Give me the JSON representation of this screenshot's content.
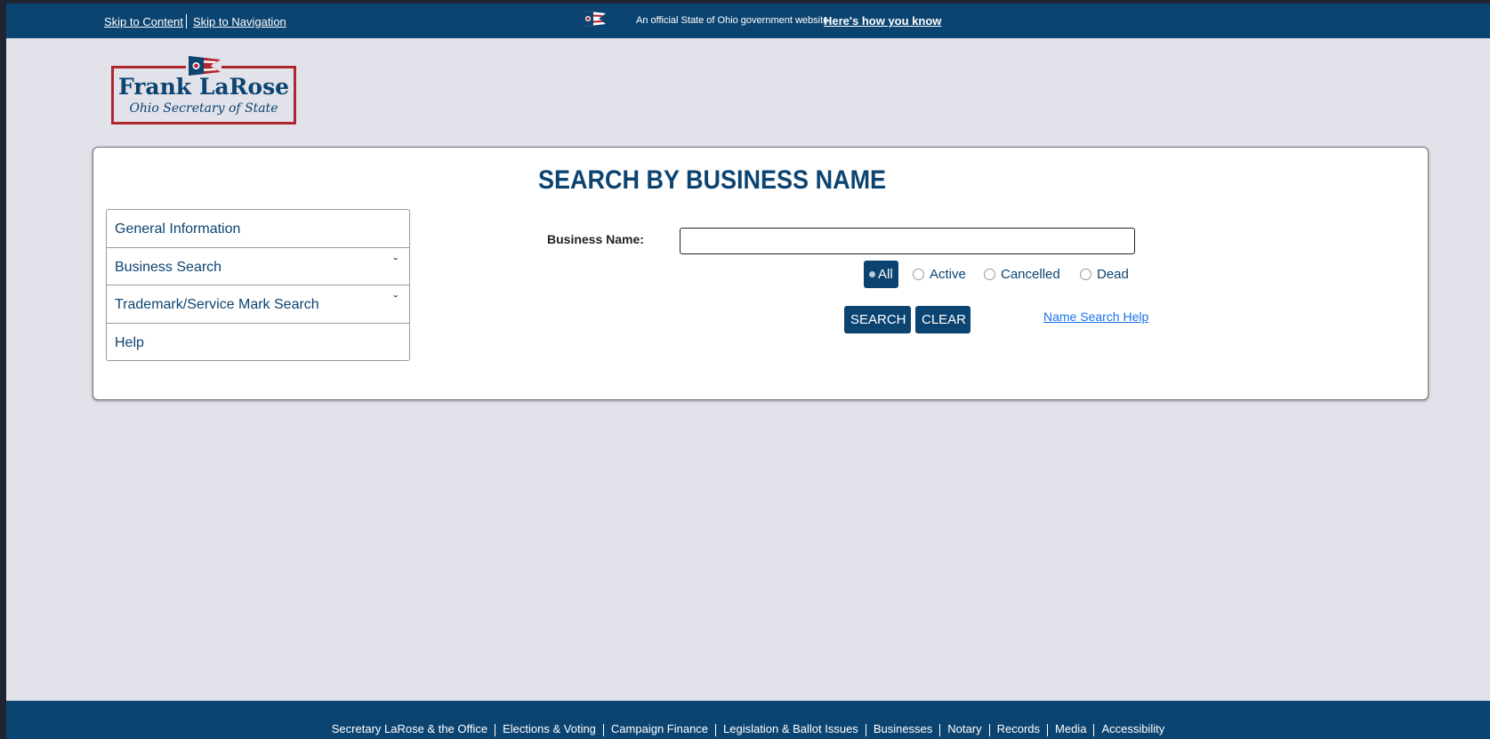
{
  "topbar": {
    "skip_content": "Skip to Content",
    "skip_navigation": "Skip to Navigation",
    "official_text": "An official State of Ohio government website.",
    "how_you_know": "Here's how you know",
    "flag_icon": "ohio-flag-icon"
  },
  "logo": {
    "name": "Frank LaRose",
    "subtitle": "Ohio Secretary of State",
    "colors": {
      "navy": "#0c4471",
      "red": "#b0262f"
    }
  },
  "main": {
    "title": "SEARCH BY BUSINESS NAME",
    "menu": [
      {
        "label": "General Information",
        "expandable": false
      },
      {
        "label": "Business Search",
        "expandable": true,
        "chevron": "ˇ"
      },
      {
        "label": "Trademark/Service Mark Search",
        "expandable": true,
        "chevron": "ˇ"
      },
      {
        "label": "Help",
        "expandable": false
      }
    ],
    "search": {
      "label": "Business Name:",
      "value": "",
      "placeholder": "",
      "filters": [
        {
          "label": "All",
          "selected": true
        },
        {
          "label": "Active",
          "selected": false
        },
        {
          "label": "Cancelled",
          "selected": false
        },
        {
          "label": "Dead",
          "selected": false
        }
      ],
      "search_button": "SEARCH",
      "clear_button": "CLEAR",
      "help_link": "Name Search Help"
    }
  },
  "footer": {
    "links": [
      "Secretary LaRose & the Office",
      "Elections & Voting",
      "Campaign Finance",
      "Legislation & Ballot Issues",
      "Businesses",
      "Notary",
      "Records",
      "Media",
      "Accessibility"
    ]
  },
  "colors": {
    "accent": "#0c4471",
    "page_bg": "#e1e2ea",
    "link": "#1a73e8"
  }
}
